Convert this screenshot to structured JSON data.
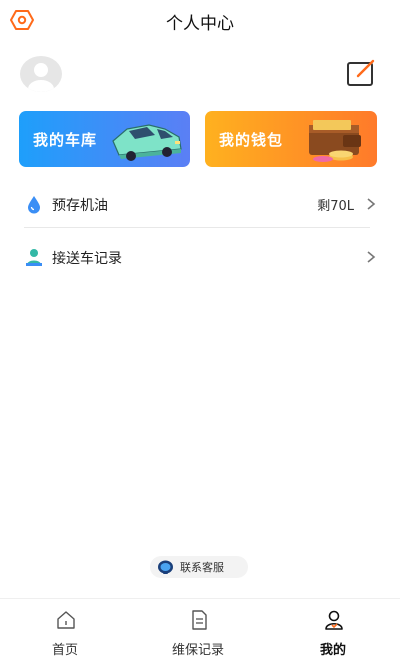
{
  "header": {
    "title": "个人中心",
    "settings_icon": "hexagon-gear-icon"
  },
  "profile": {
    "avatar_icon": "default-avatar",
    "edit_icon": "edit-square-icon"
  },
  "cards": [
    {
      "label": "我的车库",
      "illustration": "car-illustration"
    },
    {
      "label": "我的钱包",
      "illustration": "wallet-illustration"
    }
  ],
  "list": [
    {
      "label": "预存机油",
      "value": "剩70L",
      "icon": "oil-drop-icon"
    },
    {
      "label": "接送车记录",
      "icon": "driver-person-icon"
    }
  ],
  "service": {
    "label": "联系客服",
    "icon": "headset-icon"
  },
  "tabs": [
    {
      "label": "首页",
      "icon": "home-icon"
    },
    {
      "label": "维保记录",
      "icon": "document-icon"
    },
    {
      "label": "我的",
      "icon": "person-icon",
      "active": true
    }
  ],
  "colors": {
    "garage_gradient": [
      "#1e9ffb",
      "#5b7ff5"
    ],
    "wallet_gradient": [
      "#ffb11f",
      "#ff7a2a"
    ],
    "accent_orange": "#ff6a1a",
    "oil_blue": "#3a8ef5",
    "pickup_teal": "#33b8a6"
  }
}
